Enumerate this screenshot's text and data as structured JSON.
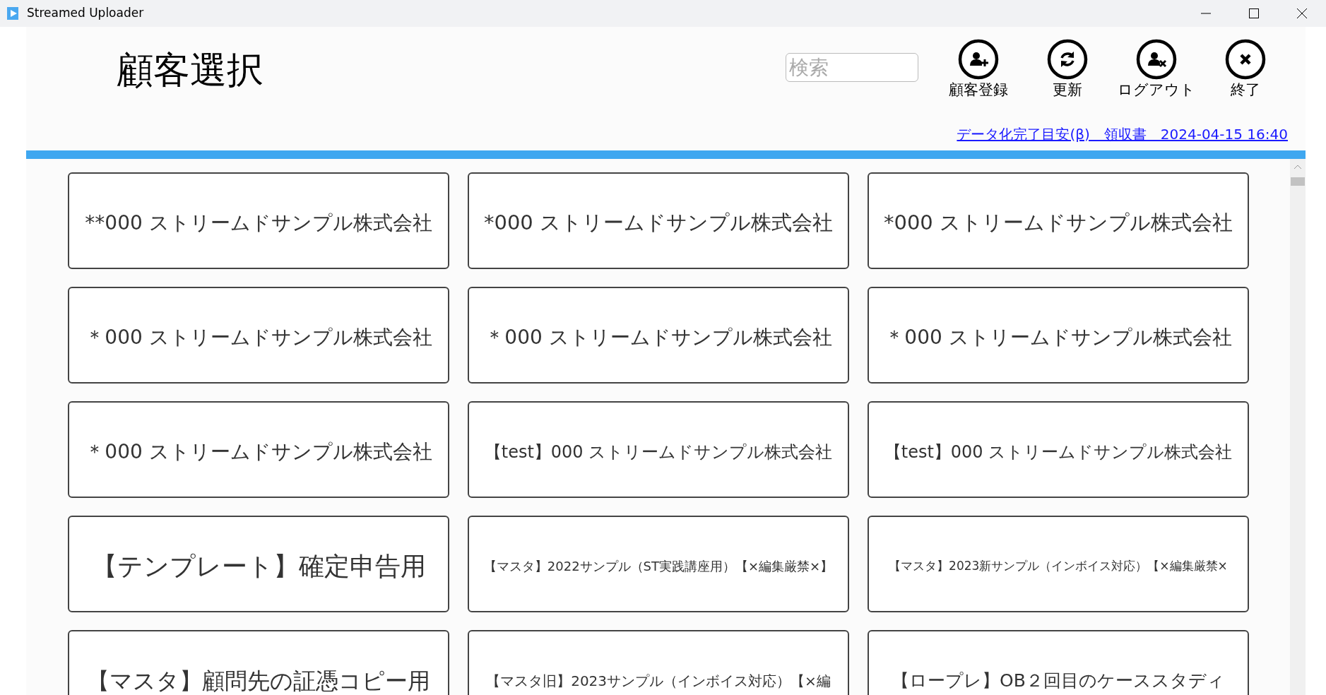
{
  "window": {
    "title": "Streamed Uploader"
  },
  "header": {
    "title": "顧客選択",
    "search": {
      "placeholder": "検索"
    },
    "actions": [
      {
        "kind": "add-user",
        "label": "顧客登録"
      },
      {
        "kind": "refresh",
        "label": "更新"
      },
      {
        "kind": "remove-user",
        "label": "ログアウト"
      },
      {
        "kind": "close",
        "label": "終了"
      }
    ],
    "link": "データ化完了目安(β)　領収書　2024-04-15 16:40"
  },
  "customers": [
    "**000 ストリームドサンプル株式会社",
    "*000 ストリームドサンプル株式会社",
    "*000 ストリームドサンプル株式会社",
    "＊000 ストリームドサンプル株式会社",
    "＊000 ストリームドサンプル株式会社",
    "＊000 ストリームドサンプル株式会社",
    "＊000 ストリームドサンプル株式会社",
    "【test】000 ストリームドサンプル株式会社",
    "【test】000 ストリームドサンプル株式会社",
    "【テンプレート】確定申告用",
    "【マスタ】2022サンプル（ST実践講座用）【×編集厳禁×】",
    "【マスタ】2023新サンプル（インボイス対応）【×編集厳禁×",
    "【マスタ】顧問先の証憑コピー用",
    "【マスタ旧】2023サンプル（インボイス対応）【×編",
    "【ロープレ】OB２回目のケーススタディ"
  ]
}
